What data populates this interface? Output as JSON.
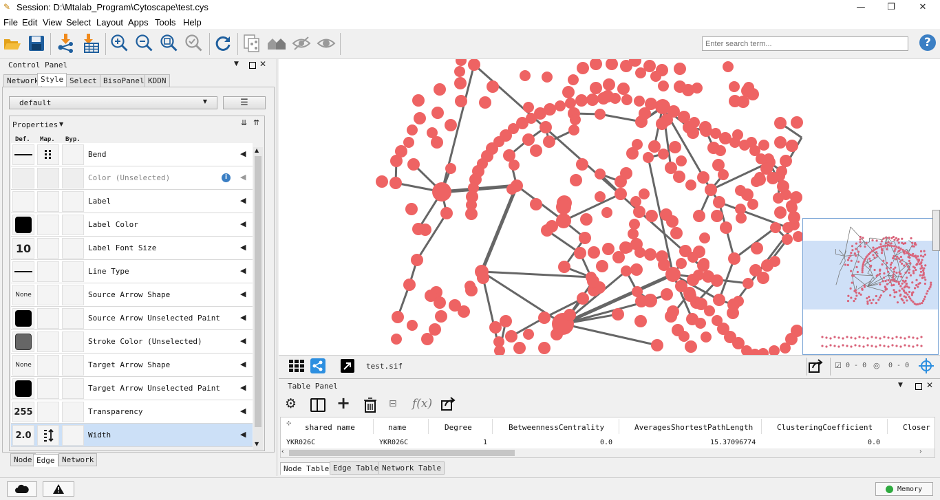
{
  "window": {
    "title": "Session: D:\\Mtalab_Program\\Cytoscape\\test.cys",
    "minimize": "—",
    "restore": "❐",
    "close": "✕"
  },
  "menu": [
    "File",
    "Edit",
    "View",
    "Select",
    "Layout",
    "Apps",
    "Tools",
    "Help"
  ],
  "toolbar": {
    "icons": [
      "open-session-icon",
      "save-session-icon",
      "import-network-icon",
      "import-table-icon",
      "zoom-in-icon",
      "zoom-out-icon",
      "zoom-fit-icon",
      "zoom-selected-icon",
      "refresh-icon",
      "new-network-from-selection-icon",
      "home-icon",
      "hide-icon",
      "show-icon"
    ],
    "search_placeholder": "Enter search term...",
    "help": "?"
  },
  "control_panel": {
    "title": "Control Panel",
    "tabs": [
      "Network",
      "Style",
      "Select",
      "BisoPanel",
      "KDDN"
    ],
    "active_tab": "Style",
    "style_name": "default",
    "properties_label": "Properties",
    "columns": [
      "Def.",
      "Map.",
      "Byp."
    ],
    "rows": [
      {
        "label": "Bend",
        "def": "line",
        "map": "dots",
        "disabled": false
      },
      {
        "label": "Color (Unselected)",
        "def": "",
        "map": "",
        "disabled": true,
        "info": true
      },
      {
        "label": "Label",
        "def": "",
        "map": "",
        "disabled": false
      },
      {
        "label": "Label Color",
        "def": "swatch-black",
        "map": "",
        "disabled": false
      },
      {
        "label": "Label Font Size",
        "def": "10",
        "map": "",
        "disabled": false
      },
      {
        "label": "Line Type",
        "def": "line",
        "map": "",
        "disabled": false
      },
      {
        "label": "Source Arrow Shape",
        "def": "None",
        "map": "",
        "disabled": false
      },
      {
        "label": "Source Arrow Unselected Paint",
        "def": "swatch-black",
        "map": "",
        "disabled": false
      },
      {
        "label": "Stroke Color (Unselected)",
        "def": "swatch-gray",
        "map": "",
        "disabled": false
      },
      {
        "label": "Target Arrow Shape",
        "def": "None",
        "map": "",
        "disabled": false
      },
      {
        "label": "Target Arrow Unselected Paint",
        "def": "swatch-black",
        "map": "",
        "disabled": false
      },
      {
        "label": "Transparency",
        "def": "255",
        "map": "",
        "disabled": false
      },
      {
        "label": "Width",
        "def": "2.0",
        "map": "continuous",
        "disabled": false,
        "selected": true
      }
    ],
    "bottom_tabs": [
      "Node",
      "Edge",
      "Network"
    ],
    "active_bottom_tab": "Edge"
  },
  "network_view": {
    "network_name": "test.sif",
    "selected_nodes": "0 - 0",
    "hidden_nodes": "0 - 0",
    "node_color": "#ee6363",
    "edge_color": "#666666"
  },
  "table_panel": {
    "title": "Table Panel",
    "columns": [
      "shared name",
      "name",
      "Degree",
      "BetweennessCentrality",
      "AveragesShortestPathLength",
      "ClusteringCoefficient",
      "Closer"
    ],
    "row": [
      "YKR026C",
      "YKR026C",
      "1",
      "0.0",
      "15.37096774",
      "0.0"
    ],
    "tabs": [
      "Node Table",
      "Edge Table",
      "Network Table"
    ],
    "active_tab": "Node Table"
  },
  "status": {
    "memory": "Memory",
    "memory_color": "#2eaa3f"
  }
}
